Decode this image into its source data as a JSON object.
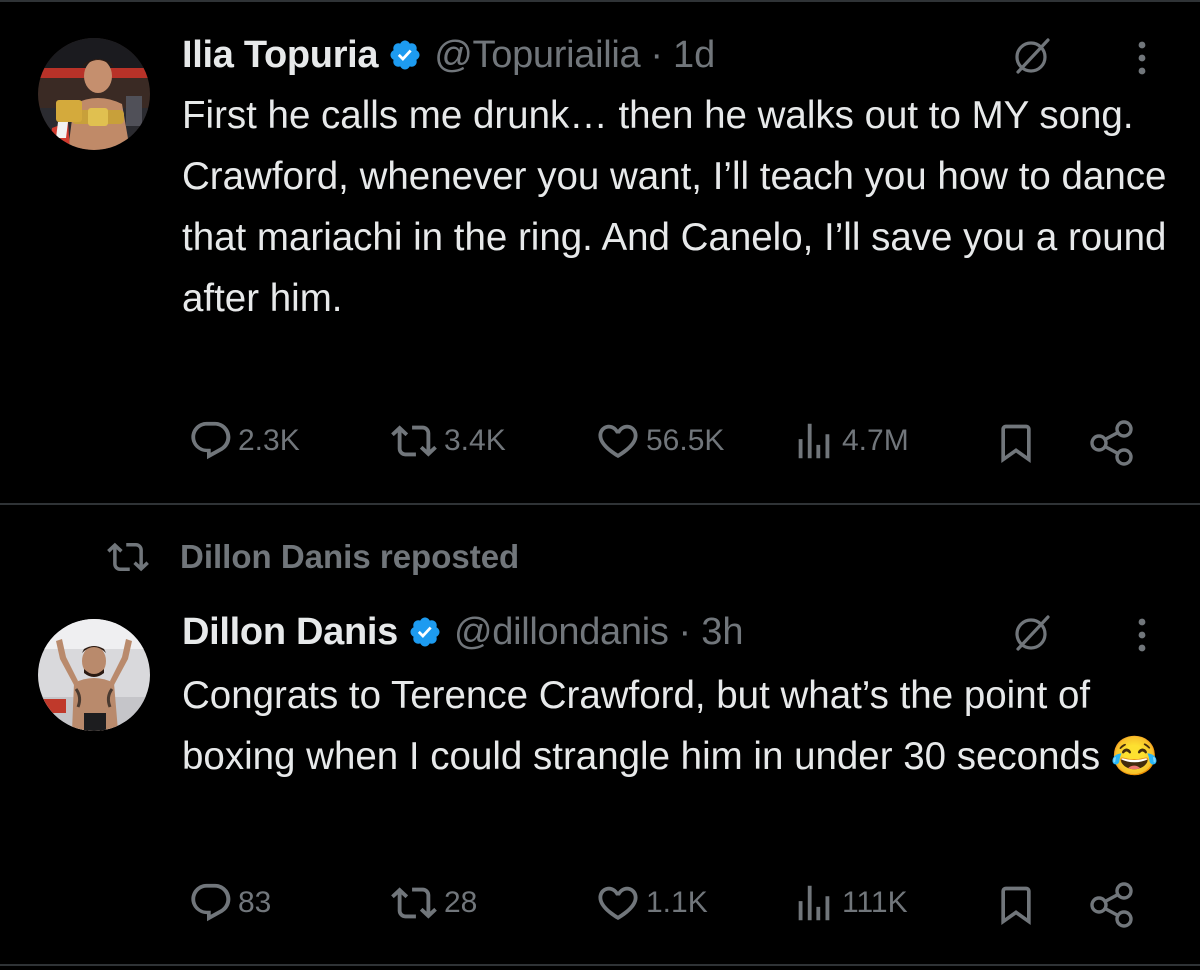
{
  "colors": {
    "background": "#000000",
    "text_primary": "#e7e9ea",
    "text_secondary": "#71767b",
    "verified_badge": "#1d9bf0",
    "divider": "#2f3336"
  },
  "tweets": [
    {
      "display_name": "Ilia Topuria",
      "handle": "@Topuriailia",
      "separator": "·",
      "time": "1d",
      "text": "First he calls me drunk… then he walks out to MY song. Crawford, whenever you want, I’ll teach you how to dance that mariachi in the ring. And Canelo, I’ll save you a round after him.",
      "metrics": {
        "replies": "2.3K",
        "reposts": "3.4K",
        "likes": "56.5K",
        "views": "4.7M"
      },
      "icons": [
        "reply-icon",
        "repost-icon",
        "like-icon",
        "views-icon",
        "bookmark-icon",
        "share-icon",
        "grok-icon",
        "more-icon",
        "verified-icon"
      ]
    },
    {
      "repost_label": "Dillon Danis reposted",
      "display_name": "Dillon Danis",
      "handle": "@dillondanis",
      "separator": "·",
      "time": "3h",
      "text": "Congrats to Terence Crawford, but what’s the point of boxing when I could strangle him in under 30 seconds",
      "emoji": "😂",
      "metrics": {
        "replies": "83",
        "reposts": "28",
        "likes": "1.1K",
        "views": "111K"
      },
      "icons": [
        "reply-icon",
        "repost-icon",
        "like-icon",
        "views-icon",
        "bookmark-icon",
        "share-icon",
        "grok-icon",
        "more-icon",
        "verified-icon"
      ]
    }
  ]
}
